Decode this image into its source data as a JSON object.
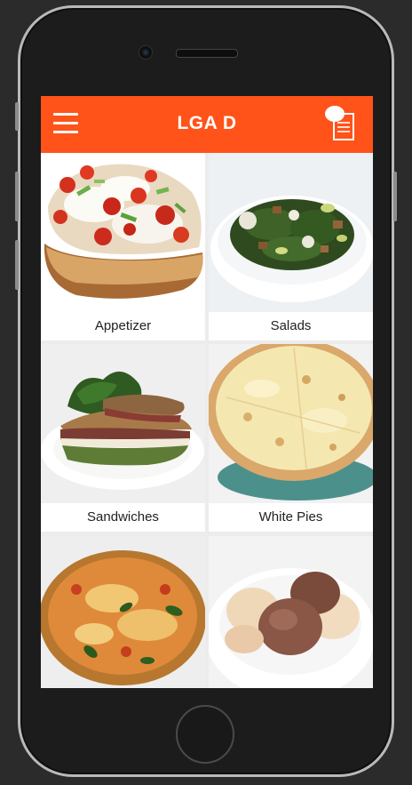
{
  "header": {
    "title": "LGA D",
    "menu_icon": "hamburger-menu-icon",
    "order_icon": "order-document-icon"
  },
  "menu": {
    "categories": [
      {
        "label": "Appetizer",
        "image": "bruschetta-photo"
      },
      {
        "label": "Salads",
        "image": "kale-salad-photo"
      },
      {
        "label": "Sandwiches",
        "image": "panini-photo"
      },
      {
        "label": "White Pies",
        "image": "white-pizza-photo"
      },
      {
        "label": "",
        "image": "margherita-pizza-photo"
      },
      {
        "label": "",
        "image": "gelato-photo"
      }
    ]
  },
  "colors": {
    "brand": "#ff5319"
  }
}
